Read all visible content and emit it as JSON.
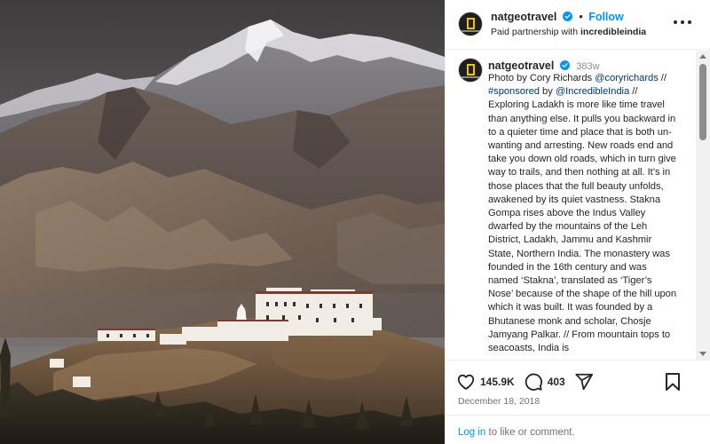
{
  "post": {
    "image_alt": "Stakna Gompa monastery beneath the mountains of Ladakh",
    "header": {
      "username": "natgeotravel",
      "separator": "•",
      "follow_label": "Follow",
      "partnership_prefix": "Paid partnership with ",
      "partner": "incredibleindia",
      "more_icon": "more-horizontal-icon"
    },
    "caption": {
      "username": "natgeotravel",
      "time_ago": "383w",
      "segments": {
        "s1": "Photo by Cory Richards ",
        "m1": "@coryrichards",
        "s2": " // ",
        "m2": "#sponsored",
        "s3": " by ",
        "m3": "@IncredibleIndia",
        "s4": " // Exploring Ladakh is more like time travel than anything else. It pulls you backward in to a quieter time and place that is both un-wanting and arresting. New roads end and take you down old roads, which in turn give way to trails, and then nothing at all. It’s in those places that the full beauty unfolds, awakened by its quiet vastness. Stakna Gompa rises above the Indus Valley dwarfed by the mountains of the Leh District, Ladakh, Jammu and Kashmir State, Northern India. The monastery was founded in the 16th century and was named ‘Stakna’, translated as ‘Tiger’s Nose’ because of the shape of the hill upon which it was built. It was founded by a Bhutanese monk and scholar, Chosje Jamyang Palkar. // From mountain tops to seacoasts, India is"
      }
    },
    "actions": {
      "like_icon": "heart-icon",
      "likes": "145.9K",
      "comment_icon": "comment-icon",
      "comments": "403",
      "share_icon": "share-icon",
      "save_icon": "bookmark-icon"
    },
    "date": "December 18, 2018",
    "login": {
      "link_label": "Log in",
      "suffix": " to like or comment."
    }
  },
  "colors": {
    "accent": "#0095f6",
    "mention": "#00376b",
    "verified": "#0095f6",
    "text": "#262626",
    "muted": "#737373"
  }
}
